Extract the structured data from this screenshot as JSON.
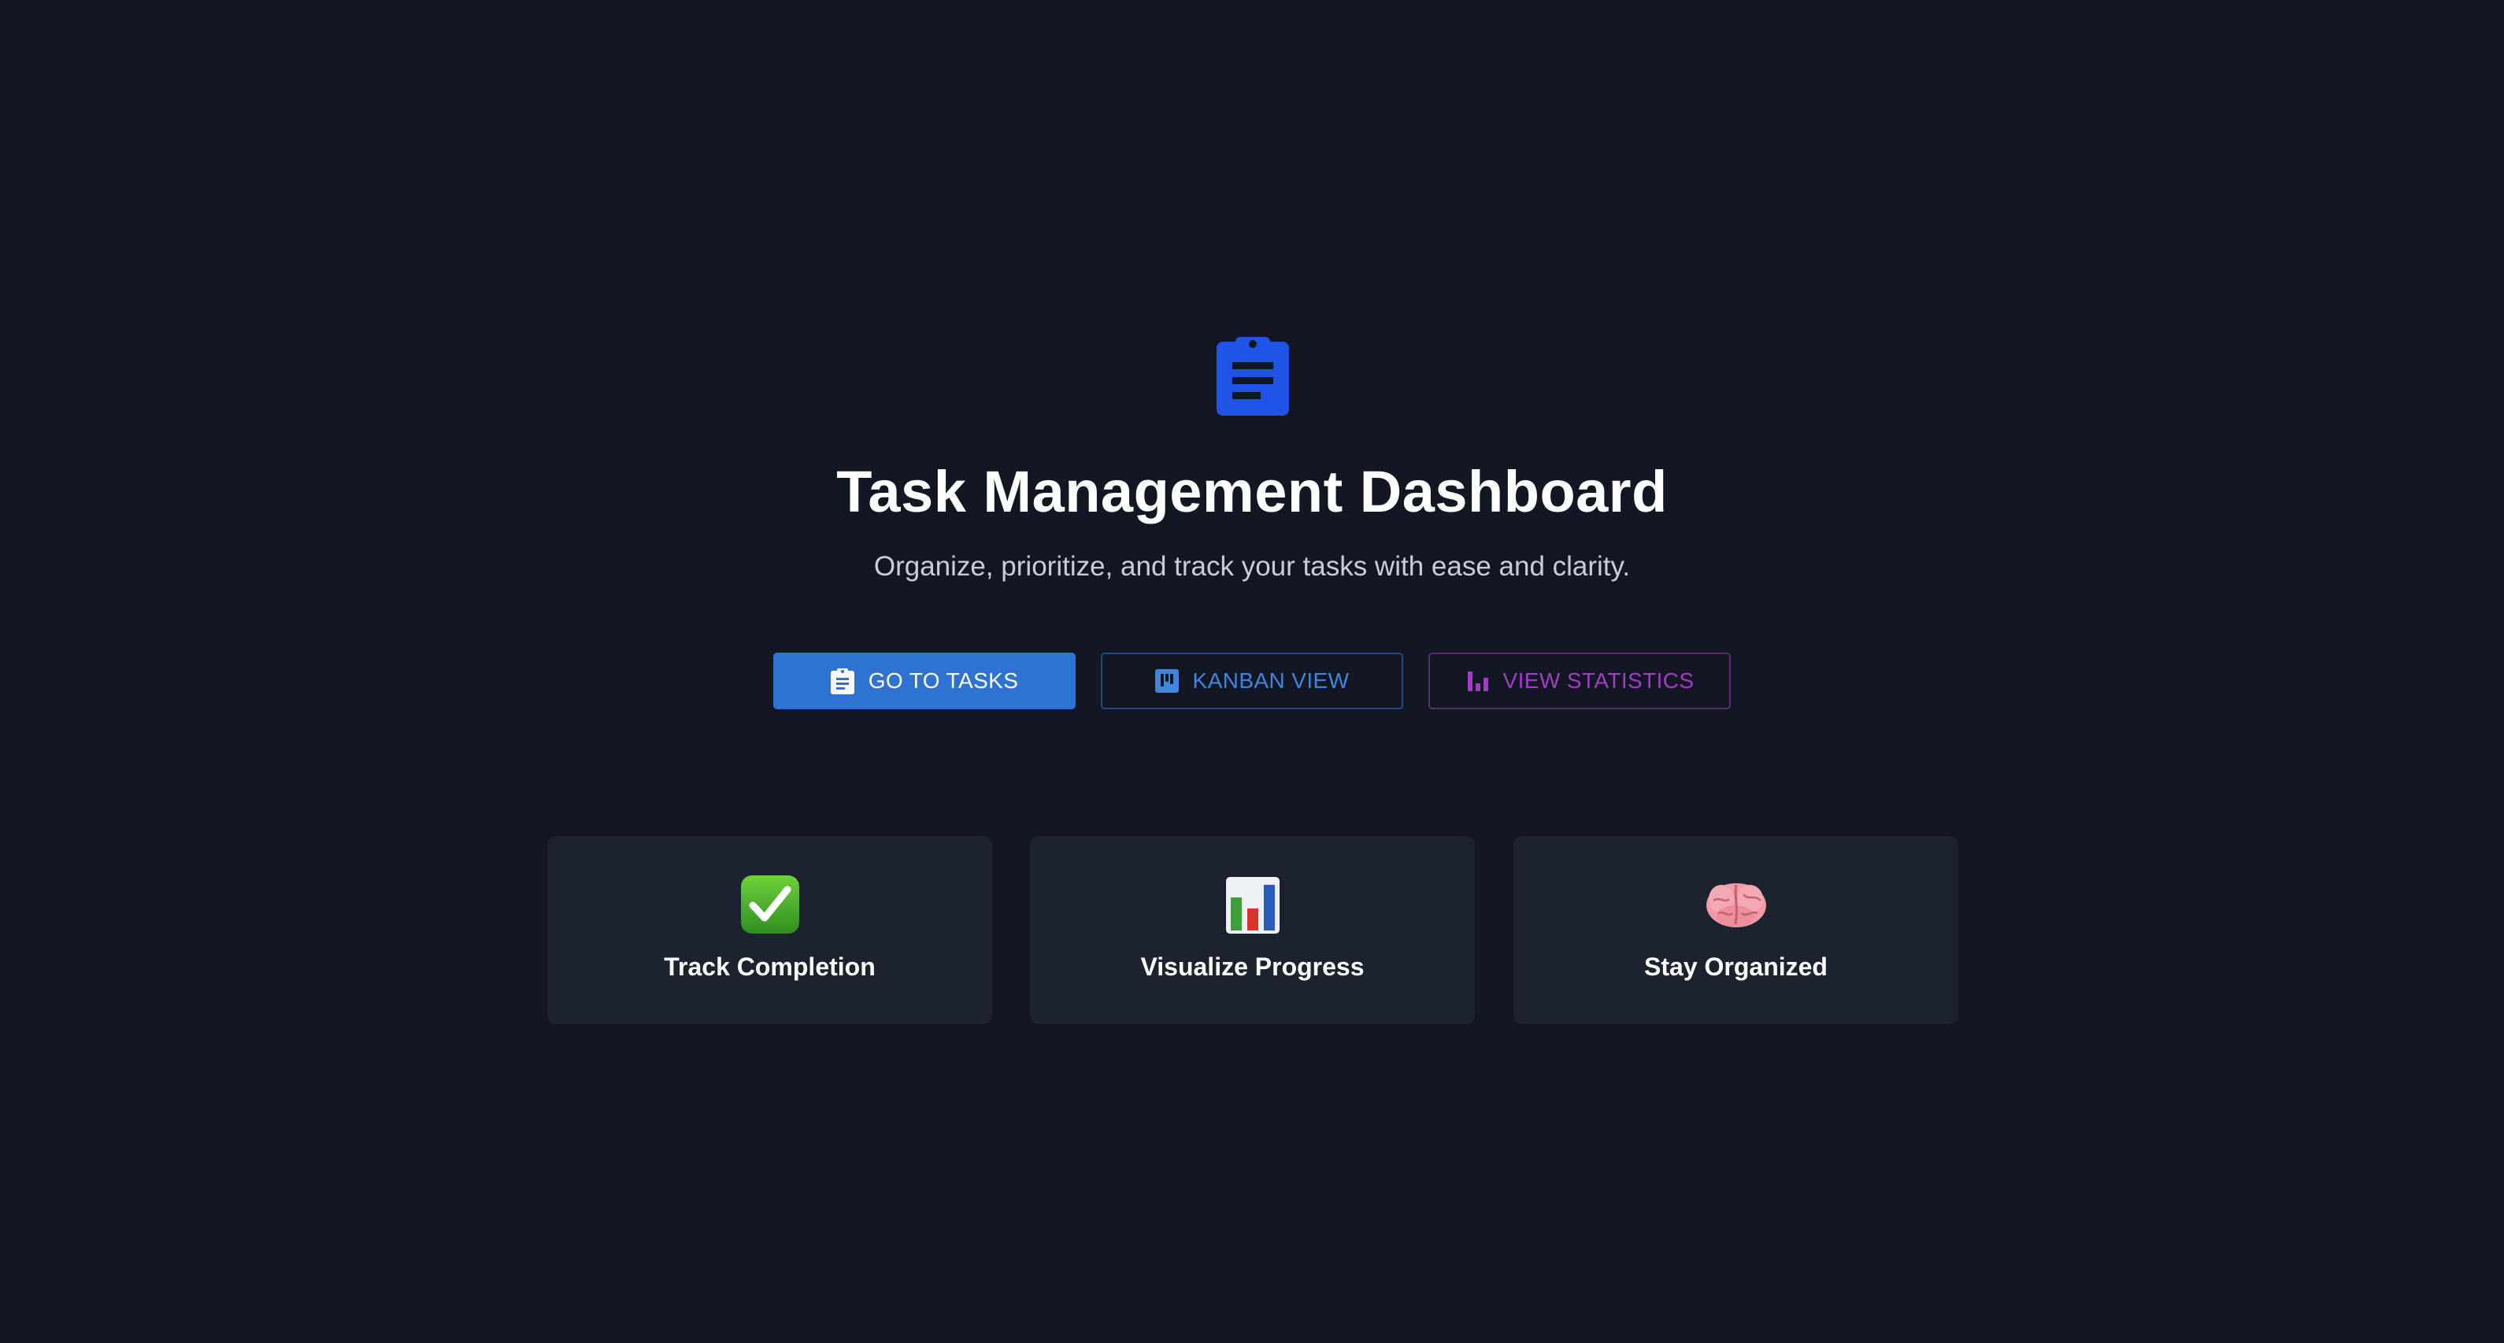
{
  "header": {
    "icon": "clipboard-icon",
    "title": "Task Management Dashboard",
    "subtitle": "Organize, prioritize, and track your tasks with ease and clarity."
  },
  "actions": {
    "go_to_tasks": {
      "label": "GO TO TASKS",
      "icon": "clipboard-icon"
    },
    "kanban_view": {
      "label": "KANBAN VIEW",
      "icon": "kanban-board-icon"
    },
    "view_statistics": {
      "label": "VIEW STATISTICS",
      "icon": "bar-chart-icon"
    }
  },
  "features": [
    {
      "icon": "check-mark-icon",
      "title": "Track Completion"
    },
    {
      "icon": "bar-chart-icon",
      "title": "Visualize Progress"
    },
    {
      "icon": "brain-icon",
      "title": "Stay Organized"
    }
  ],
  "colors": {
    "background": "#121723",
    "card": "#1d232e",
    "primary": "#2e72d2",
    "hero_icon": "#1f54e6",
    "kanban": "#3f86e0",
    "statistics": "#a13ec2"
  }
}
